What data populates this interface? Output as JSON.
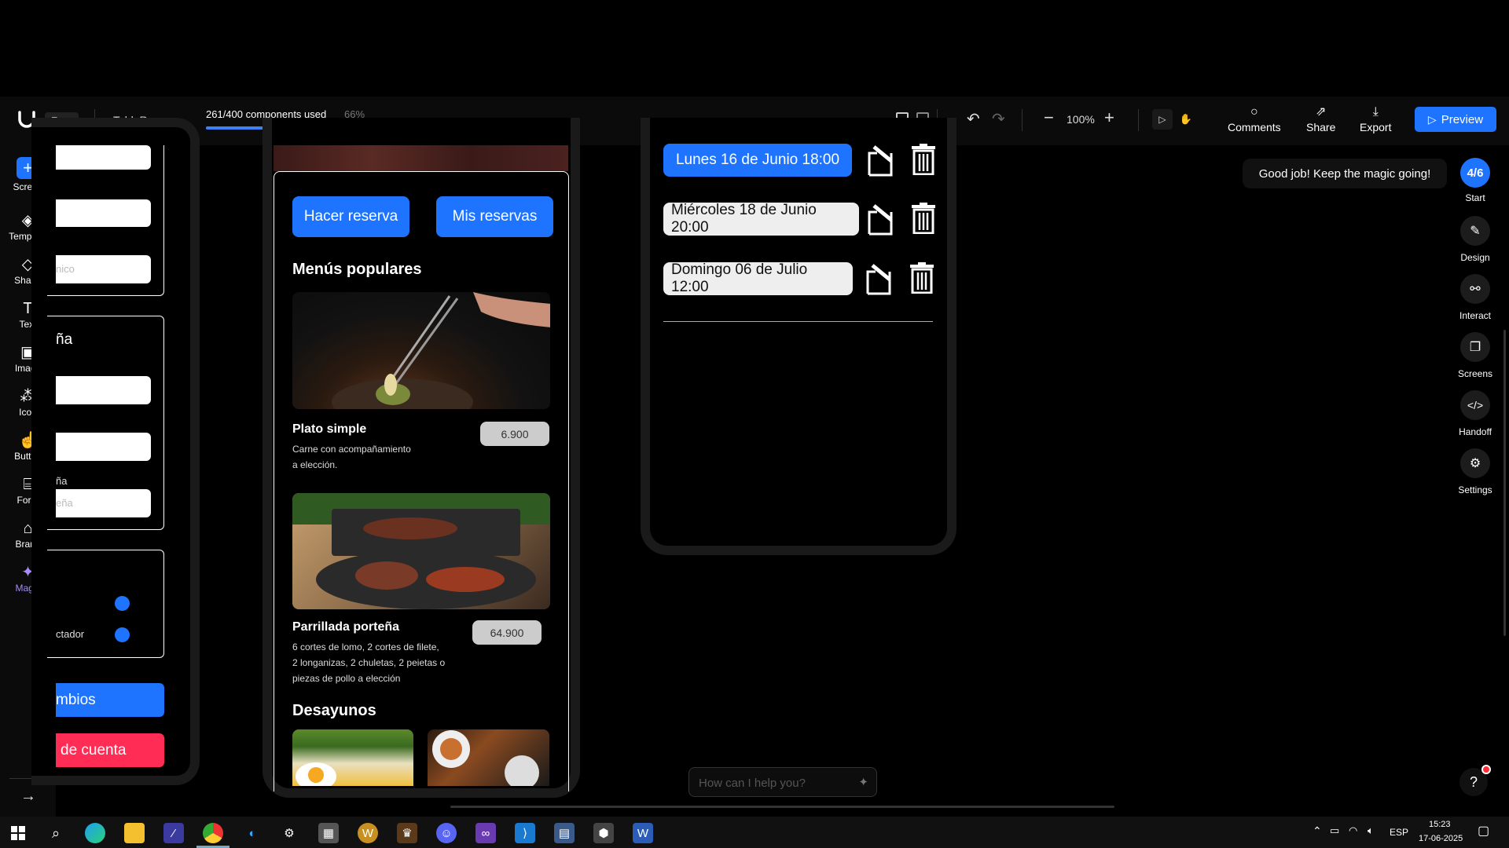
{
  "app": {
    "project_name": "TableReserve",
    "plan_badge": "Free",
    "components_used": "261/400 components used",
    "components_percent": "66%",
    "components_progress": 0.66,
    "zoom": "100%",
    "comments_label": "Comments",
    "share_label": "Share",
    "export_label": "Export",
    "preview_label": "Preview"
  },
  "left_sidebar": {
    "items": [
      {
        "label": "Screen",
        "icon": "plus-icon"
      },
      {
        "label": "Template",
        "icon": "layers-icon"
      },
      {
        "label": "Shape",
        "icon": "shape-icon"
      },
      {
        "label": "Text",
        "icon": "text-icon"
      },
      {
        "label": "Image",
        "icon": "image-icon"
      },
      {
        "label": "Icon",
        "icon": "icon-icon"
      },
      {
        "label": "Button",
        "icon": "button-icon"
      },
      {
        "label": "Form",
        "icon": "form-icon"
      },
      {
        "label": "Brand",
        "icon": "brand-icon"
      },
      {
        "label": "Magic",
        "icon": "magic-icon"
      }
    ],
    "expand_icon": "arrow-right-icon"
  },
  "right_sidebar": {
    "toast": "Good job! Keep the magic going!",
    "progress_badge": "4/6",
    "start_label": "Start",
    "items": [
      {
        "label": "Design",
        "icon": "pencil-icon"
      },
      {
        "label": "Interact",
        "icon": "link-icon"
      },
      {
        "label": "Screens",
        "icon": "screens-icon"
      },
      {
        "label": "Handoff",
        "icon": "code-icon"
      },
      {
        "label": "Settings",
        "icon": "gear-icon"
      }
    ]
  },
  "screen_left": {
    "placeholder_fragment_1": "nico",
    "heading_fragment": "ña",
    "label_fragment": "ña",
    "placeholder_fragment_2": "eña",
    "toggle_label_fragment": "ctador",
    "save_button_fragment": "mbios",
    "delete_button_fragment": "de cuenta"
  },
  "screen_middle": {
    "make_reservation": "Hacer reserva",
    "my_reservations": "Mis reservas",
    "popular_heading": "Menús populares",
    "items": [
      {
        "name": "Plato simple",
        "description_line1": "Carne con acompañamiento",
        "description_line2": "a elección.",
        "price": "6.900"
      },
      {
        "name": "Parrillada porteña",
        "description_line1": "6 cortes de lomo, 2 cortes de filete,",
        "description_line2": "2 longanizas, 2 chuletas, 2 peietas o",
        "description_line3": "piezas de pollo a elección",
        "price": "64.900"
      }
    ],
    "breakfast_heading": "Desayunos"
  },
  "screen_right": {
    "reservations": [
      {
        "label": "Lunes 16 de Junio 18:00",
        "highlight": true
      },
      {
        "label": "Miércoles 18 de Junio 20:00",
        "highlight": false
      },
      {
        "label": "Domingo 06 de Julio 12:00",
        "highlight": false
      }
    ]
  },
  "assistant": {
    "placeholder": "How can I help you?",
    "help_label": "?"
  },
  "taskbar": {
    "language": "ESP",
    "time": "15:23",
    "date": "17-06-2025"
  },
  "colors": {
    "accent": "#1e74ff",
    "danger": "#ff2d55",
    "background": "#000000"
  }
}
